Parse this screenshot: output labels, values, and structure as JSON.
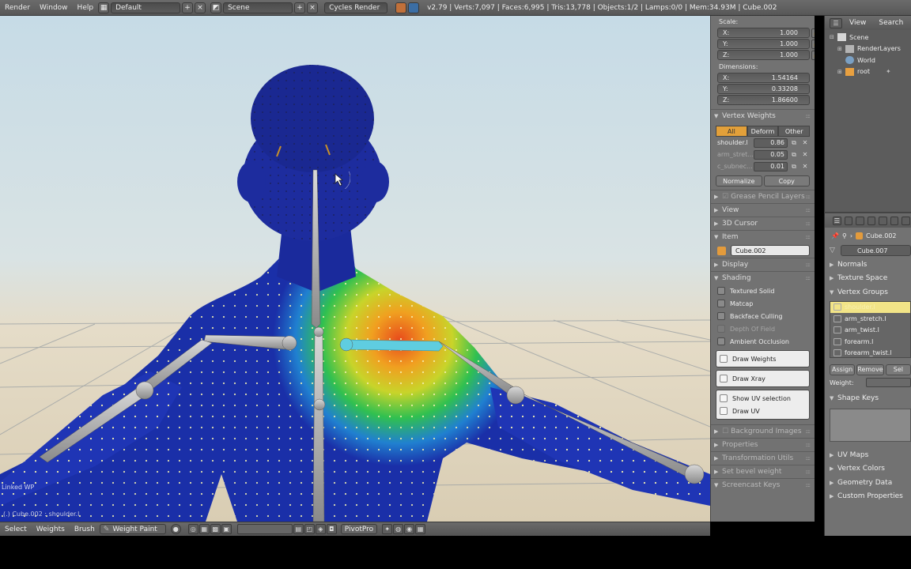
{
  "top_menu": {
    "render": "Render",
    "window": "Window",
    "help": "Help"
  },
  "layout_name": "Default",
  "scene_name": "Scene",
  "engine": "Cycles Render",
  "stats": "v2.79 | Verts:7,097 | Faces:6,995 | Tris:13,778 | Objects:1/2 | Lamps:0/0 | Mem:34.93M | Cube.002",
  "viewport": {
    "linked_label": "Linked WP",
    "object_label": "(.) Cube.002 : shoulder.l",
    "header": {
      "select": "Select",
      "weights": "Weights",
      "brush": "Brush",
      "mode": "Weight Paint",
      "pivot": "PivotPro"
    }
  },
  "npanel": {
    "scale_label": "Scale:",
    "scale": [
      {
        "k": "X:",
        "v": "1.000"
      },
      {
        "k": "Y:",
        "v": "1.000"
      },
      {
        "k": "Z:",
        "v": "1.000"
      }
    ],
    "dimensions_label": "Dimensions:",
    "dimensions": [
      {
        "k": "X:",
        "v": "1.54164"
      },
      {
        "k": "Y:",
        "v": "0.33208"
      },
      {
        "k": "Z:",
        "v": "1.86600"
      }
    ],
    "vertex_weights": {
      "title": "Vertex Weights",
      "tabs": [
        "All",
        "Deform",
        "Other"
      ],
      "rows": [
        {
          "name": "shoulder.l",
          "value": "0.86"
        },
        {
          "name": "arm_stret...",
          "value": "0.05"
        },
        {
          "name": "c_subnec...",
          "value": "0.01"
        }
      ],
      "normalize": "Normalize",
      "copy": "Copy"
    },
    "grease_pencil": "Grease Pencil Layers",
    "view": "View",
    "cursor": "3D Cursor",
    "item": "Item",
    "item_name": "Cube.002",
    "display": "Display",
    "shading": "Shading",
    "shading_opts": [
      "Textured Solid",
      "Matcap",
      "Backface Culling",
      "Depth Of Field",
      "Ambient Occlusion"
    ],
    "draw_weights": "Draw Weights",
    "draw_xray": "Draw Xray",
    "show_uv_selection": "Show UV selection",
    "draw_uv": "Draw UV",
    "background_images": "Background Images",
    "properties": "Properties",
    "transformation_utils": "Transformation Utils",
    "set_bevel_weight": "Set bevel weight",
    "screencast_keys": "Screencast Keys"
  },
  "outliner": {
    "view": "View",
    "search": "Search",
    "items": [
      {
        "label": "Scene",
        "level": 0
      },
      {
        "label": "RenderLayers",
        "level": 1
      },
      {
        "label": "World",
        "level": 1
      },
      {
        "label": "root",
        "level": 1
      }
    ]
  },
  "properties": {
    "crumb": "Cube.002",
    "object_data_name": "Cube.007",
    "normals": "Normals",
    "texture_space": "Texture Space",
    "vertex_groups": "Vertex Groups",
    "groups": [
      "shoulder.l",
      "arm_stretch.l",
      "arm_twist.l",
      "forearm.l",
      "forearm_twist.l"
    ],
    "assign": "Assign",
    "remove": "Remove",
    "select": "Sel",
    "weight": "Weight:",
    "shape_keys": "Shape Keys",
    "uv_maps": "UV Maps",
    "vertex_colors": "Vertex Colors",
    "geometry_data": "Geometry Data",
    "custom_properties": "Custom Properties"
  }
}
